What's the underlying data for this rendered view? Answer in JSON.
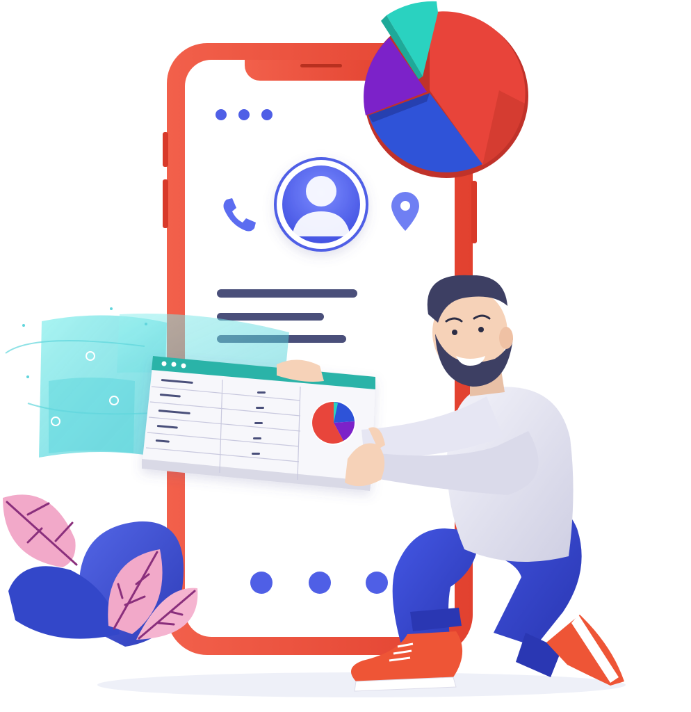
{
  "illustration": {
    "type": "flat-3d-illustration",
    "subject": "man-holding-spreadsheet-next-to-phone",
    "texts": []
  },
  "colors": {
    "phone_frame": "#f0503c",
    "phone_screen": "#ffffff",
    "accent_blue": "#4f5fe6",
    "text_lines": "#4a4f7a",
    "pie_red": "#e8443a",
    "pie_blue": "#2f53d8",
    "pie_purple": "#7c22c9",
    "pie_teal": "#2ad2c0",
    "hologram": "#5fd9e0",
    "shirt": "#e6e6f3",
    "pants": "#3344cc",
    "shoes": "#ee5536",
    "hair": "#3d3f63",
    "skin": "#f6d2b8",
    "leaf_pink": "#f0a7c8",
    "leaf_blue": "#3c4fd6",
    "window_header": "#2cb3a8"
  },
  "phone": {
    "dot_indicators": 3,
    "icons": [
      "phone-icon",
      "user-avatar-icon",
      "location-pin-icon"
    ],
    "text_line_count": 3,
    "bottom_dots": 3
  },
  "pie_chart_3d": {
    "slices": [
      {
        "color": "red",
        "share": 0.45
      },
      {
        "color": "blue",
        "share": 0.25
      },
      {
        "color": "purple",
        "share": 0.2
      },
      {
        "color": "teal",
        "share": 0.1
      }
    ]
  },
  "spreadsheet_window": {
    "window_dots": 3,
    "rows": 6,
    "has_pie": true
  }
}
